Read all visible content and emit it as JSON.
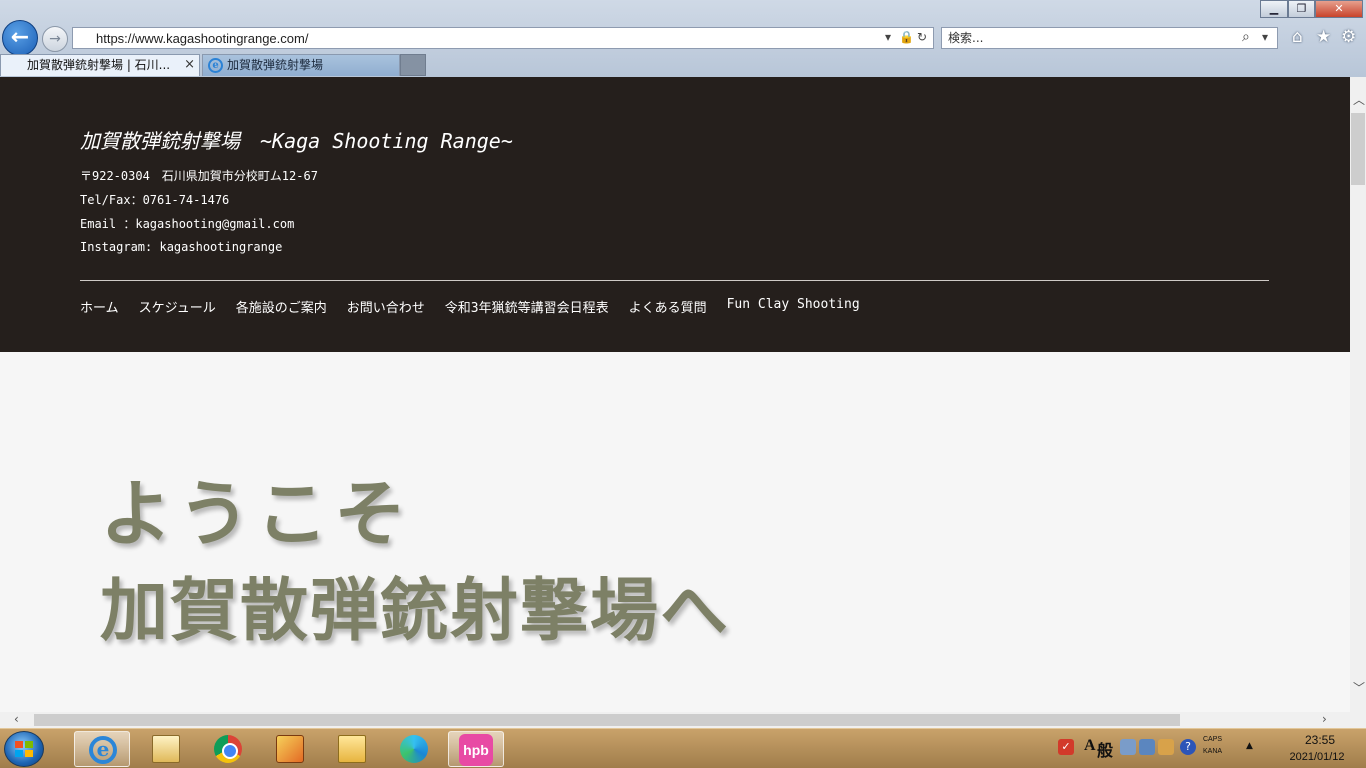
{
  "browser": {
    "address": "https://www.kagashootingrange.com/",
    "search_placeholder": "検索...",
    "tabs": [
      {
        "label": "加賀散弾銃射撃場 | 石川..."
      },
      {
        "label": "加賀散弾銃射撃場"
      }
    ],
    "icons": {
      "back": "back-arrow-icon",
      "forward": "forward-arrow-icon",
      "lock": "lock-icon",
      "refresh": "refresh-icon",
      "search": "magnifier-icon",
      "home": "home-icon",
      "favorites": "star-icon",
      "tools": "gear-icon"
    }
  },
  "site": {
    "title": "加賀散弾銃射撃場　~Kaga Shooting Range~",
    "address": "〒922-0304　石川県加賀市分校町ム12-67",
    "tel": "Tel/Fax：0761-74-1476",
    "email": "Email ：kagashooting@gmail.com",
    "instagram": "Instagram: kagashootingrange",
    "nav": [
      "ホーム",
      "スケジュール",
      "各施設のご案内",
      "お問い合わせ",
      "令和3年猟銃等講習会日程表",
      "よくある質問",
      "Fun Clay Shooting"
    ],
    "hero_line1": "ようこそ",
    "hero_line2": "加賀散弾銃射撃場へ"
  },
  "taskbar": {
    "ime_mode": "般",
    "ime_letter": "A",
    "caps": "CAPS",
    "kana": "KANA",
    "time": "23:55",
    "date": "2021/01/12",
    "hpb_label": "hpb"
  },
  "colors": {
    "header_bg": "#251f1c",
    "hero_text": "#7d8066",
    "page_bg": "#f6f6f6"
  }
}
